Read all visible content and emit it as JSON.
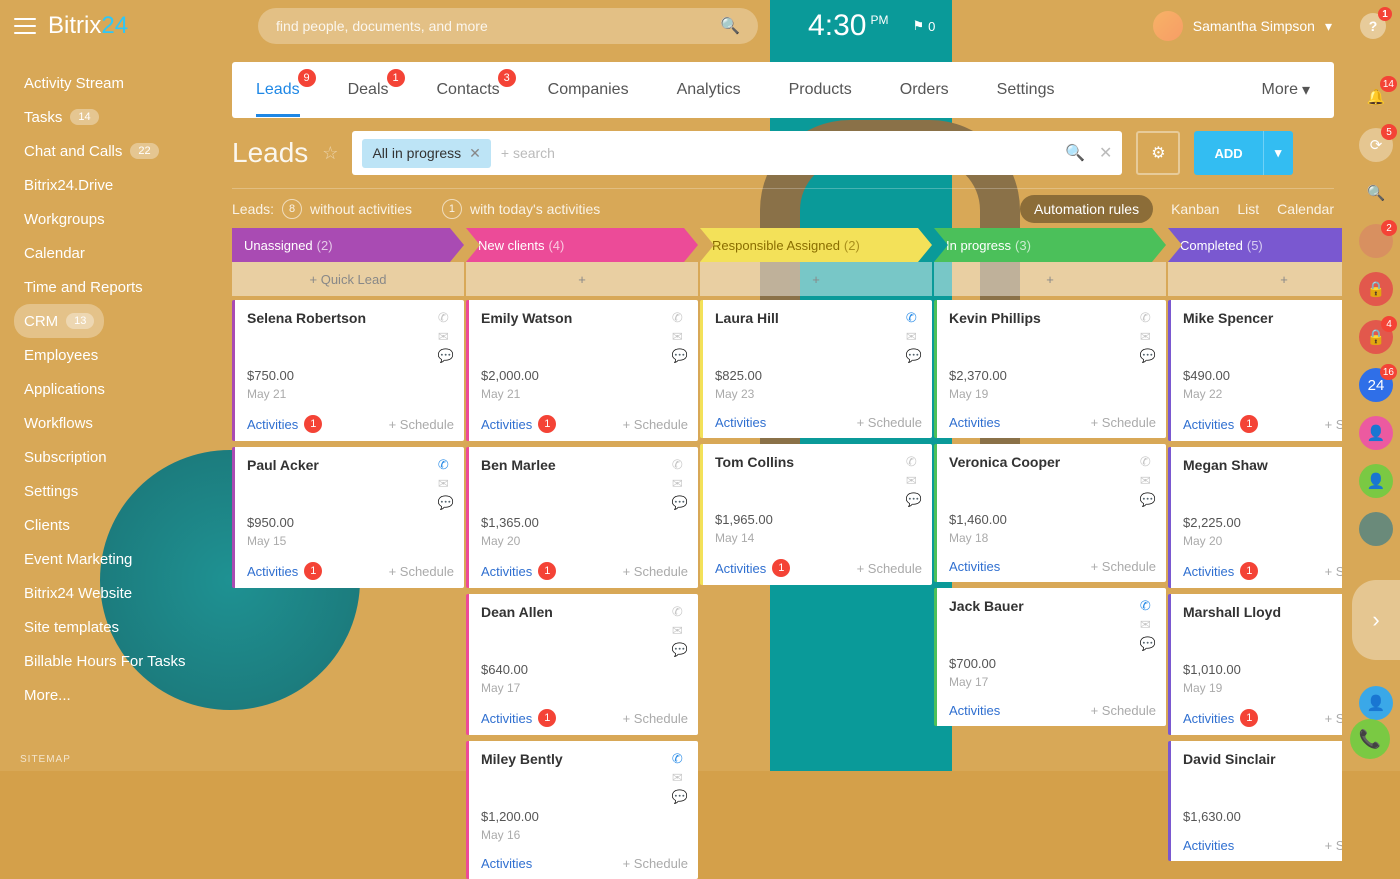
{
  "brand": {
    "p1": "Bitrix",
    "p2": "24"
  },
  "search_placeholder": "find people, documents, and more",
  "clock": {
    "time": "4:30",
    "ampm": "PM"
  },
  "notif_flag": "0",
  "user": {
    "name": "Samantha Simpson"
  },
  "help_badge": "1",
  "sidebar": [
    {
      "label": "Activity Stream"
    },
    {
      "label": "Tasks",
      "count": "14"
    },
    {
      "label": "Chat and Calls",
      "count": "22"
    },
    {
      "label": "Bitrix24.Drive"
    },
    {
      "label": "Workgroups"
    },
    {
      "label": "Calendar"
    },
    {
      "label": "Time and Reports"
    },
    {
      "label": "CRM",
      "count": "13",
      "active": true
    },
    {
      "label": "Employees"
    },
    {
      "label": "Applications"
    },
    {
      "label": "Workflows"
    },
    {
      "label": "Subscription"
    },
    {
      "label": "Settings"
    },
    {
      "label": "Clients"
    },
    {
      "label": "Event Marketing"
    },
    {
      "label": "Bitrix24 Website"
    },
    {
      "label": "Site templates"
    },
    {
      "label": "Billable Hours For Tasks"
    },
    {
      "label": "More..."
    }
  ],
  "sitemap": "SITEMAP",
  "tabs": [
    {
      "label": "Leads",
      "badge": "9",
      "active": true
    },
    {
      "label": "Deals",
      "badge": "1"
    },
    {
      "label": "Contacts",
      "badge": "3"
    },
    {
      "label": "Companies"
    },
    {
      "label": "Analytics"
    },
    {
      "label": "Products"
    },
    {
      "label": "Orders"
    },
    {
      "label": "Settings"
    }
  ],
  "tab_more": "More",
  "page_title": "Leads",
  "filter_chip": "All in progress",
  "search_hint": "+ search",
  "add_label": "ADD",
  "stats": {
    "label": "Leads:",
    "wo_count": "8",
    "wo_text": "without activities",
    "today_count": "1",
    "today_text": "with today's activities"
  },
  "views": {
    "auto": "Automation rules",
    "kanban": "Kanban",
    "list": "List",
    "calendar": "Calendar"
  },
  "quick_lead": "+  Quick Lead",
  "plus": "+",
  "act_label": "Activities",
  "sched_label": "+ Schedule",
  "columns": [
    {
      "title": "Unassigned",
      "count": "(2)",
      "cls": "c1",
      "cards": [
        {
          "name": "Selena Robertson",
          "amt": "$750.00",
          "date": "May 21",
          "ab": "1"
        },
        {
          "name": "Paul Acker",
          "amt": "$950.00",
          "date": "May 15",
          "ab": "1",
          "hot": true
        }
      ]
    },
    {
      "title": "New clients",
      "count": "(4)",
      "cls": "c2",
      "cards": [
        {
          "name": "Emily Watson",
          "amt": "$2,000.00",
          "date": "May 21",
          "ab": "1"
        },
        {
          "name": "Ben Marlee",
          "amt": "$1,365.00",
          "date": "May 20",
          "ab": "1"
        },
        {
          "name": "Dean Allen",
          "amt": "$640.00",
          "date": "May 17",
          "ab": "1"
        },
        {
          "name": "Miley Bently",
          "amt": "$1,200.00",
          "date": "May 16",
          "hot": true
        }
      ]
    },
    {
      "title": "Responsible Assigned",
      "count": "(2)",
      "cls": "c3",
      "cards": [
        {
          "name": "Laura Hill",
          "amt": "$825.00",
          "date": "May 23",
          "hot": true
        },
        {
          "name": "Tom Collins",
          "amt": "$1,965.00",
          "date": "May 14",
          "ab": "1"
        }
      ]
    },
    {
      "title": "In progress",
      "count": "(3)",
      "cls": "c4",
      "cards": [
        {
          "name": "Kevin Phillips",
          "amt": "$2,370.00",
          "date": "May 19"
        },
        {
          "name": "Veronica Cooper",
          "amt": "$1,460.00",
          "date": "May 18"
        },
        {
          "name": "Jack Bauer",
          "amt": "$700.00",
          "date": "May 17",
          "hot": true
        }
      ]
    },
    {
      "title": "Completed",
      "count": "(5)",
      "cls": "c5",
      "cards": [
        {
          "name": "Mike Spencer",
          "amt": "$490.00",
          "date": "May 22",
          "ab": "1"
        },
        {
          "name": "Megan Shaw",
          "amt": "$2,225.00",
          "date": "May 20",
          "ab": "1"
        },
        {
          "name": "Marshall Lloyd",
          "amt": "$1,010.00",
          "date": "May 19",
          "ab": "1"
        },
        {
          "name": "David Sinclair",
          "amt": "$1,630.00"
        }
      ]
    }
  ],
  "rail": [
    {
      "name": "bell-icon",
      "bg": "transparent",
      "glyph": "🔔",
      "badge": "14"
    },
    {
      "name": "history-icon",
      "bg": "rgba(255,255,255,.35)",
      "glyph": "⟳",
      "badge": "5"
    },
    {
      "name": "search-icon",
      "bg": "transparent",
      "glyph": "🔍"
    },
    {
      "name": "avatar-icon",
      "bg": "#d89060",
      "glyph": "",
      "badge": "2"
    },
    {
      "name": "lock-icon",
      "bg": "#e2584c",
      "glyph": "🔒"
    },
    {
      "name": "lock-icon-2",
      "bg": "#e2584c",
      "glyph": "🔒",
      "badge": "4"
    },
    {
      "name": "b24-icon",
      "bg": "#2f6fe8",
      "glyph": "24",
      "badge": "16"
    },
    {
      "name": "person-icon",
      "bg": "#ec5aa0",
      "glyph": "👤"
    },
    {
      "name": "person-add-icon",
      "bg": "#7ac943",
      "glyph": "👤"
    },
    {
      "name": "avatar-2-icon",
      "bg": "#6a8a7a",
      "glyph": ""
    }
  ]
}
